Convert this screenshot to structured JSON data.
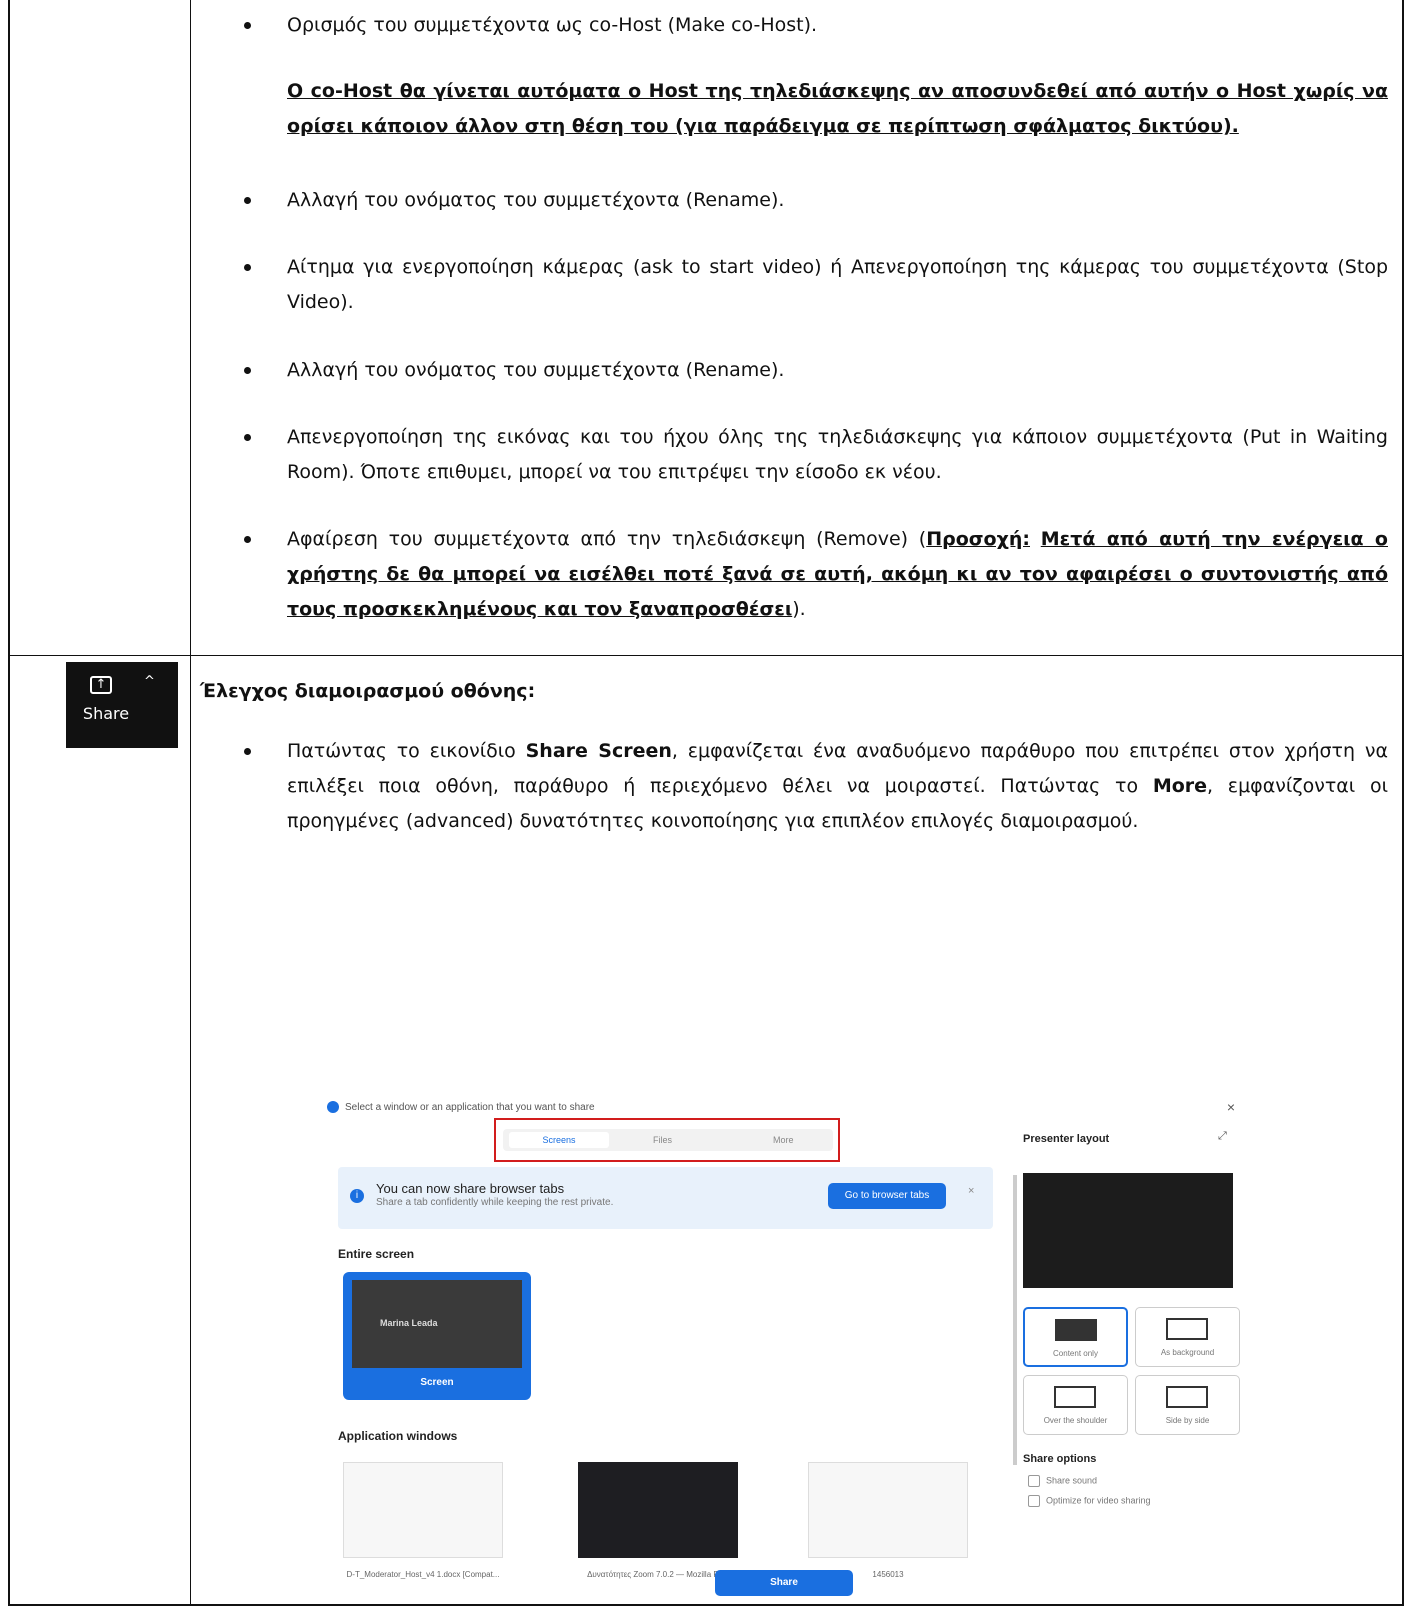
{
  "row1": {
    "bullet1": "Ορισμός του συμμετέχοντα ως co-Host (Make co-Host).",
    "note": "Ο co-Host θα γίνεται αυτόματα ο Host της τηλεδιάσκεψης αν αποσυνδεθεί από αυτήν ο Host χωρίς να ορίσει κάποιον άλλον στη θέση του (για παράδειγμα σε περίπτωση σφάλματος δικτύου).",
    "bullet2": "Αλλαγή του ονόματος του συμμετέχοντα (Rename).",
    "bullet3": "Αίτημα για ενεργοποίηση κάμερας (ask to start video) ή Απενεργοποίηση της κάμερας του συμμετέχοντα (Stop Video).",
    "bullet4": "Αλλαγή του ονόματος του συμμετέχοντα (Rename).",
    "bullet5": "Απενεργοποίηση της εικόνας και του ήχου όλης της τηλεδιάσκεψης για κάποιον συμμετέχοντα (Put in Waiting Room). Όποτε επιθυμει, μπορεί να του επιτρέψει την είσοδο εκ νέου.",
    "bullet6_pre": "Αφαίρεση του συμμετέχοντα από την τηλεδιάσκεψη (Remove) (",
    "bullet6_warn_label": "Προσοχή:",
    "bullet6_warn": "Μετά από αυτή την ενέργεια ο χρήστης δε θα μπορεί να εισέλθει ποτέ ξανά σε αυτή, ακόμη κι αν τον αφαιρέσει ο συντονιστής από τους προσκεκλημένους και τον ξαναπροσθέσει",
    "bullet6_post": ")."
  },
  "row2": {
    "share_icon_label": "Share",
    "heading": "Έλεγχος διαμοιρασμού οθόνης:",
    "bullet_pre": "Πατώντας το εικονίδιο ",
    "bullet_bold1": "Share Screen",
    "bullet_mid": ", εμφανίζεται ένα αναδυόμενο παράθυρο που επιτρέπει στον χρήστη να επιλέξει ποια οθόνη, παράθυρο ή περιεχόμενο θέλει να μοιραστεί. Πατώντας το ",
    "bullet_bold2": "More",
    "bullet_post": ", εμφανίζονται οι προηγμένες (advanced) δυνατότητες κοινοποίησης για επιπλέον επιλογές διαμοιρασμού."
  },
  "zoom": {
    "window_title": "Select a window or an application that you want to share",
    "tabs": [
      "Screens",
      "Files",
      "More"
    ],
    "banner_title": "You can now share browser tabs",
    "banner_sub": "Share a tab confidently while keeping the rest private.",
    "banner_button": "Go to browser tabs",
    "entire_screen": "Entire screen",
    "screen_name": "Marina Leada",
    "screen_label": "Screen",
    "app_windows": "Application windows",
    "thumb_captions": [
      "D-T_Moderator_Host_v4 1.docx [Compat...",
      "Δυνατότητες Zoom 7.0.2 — Mozilla Fir...",
      "1456013"
    ],
    "presenter_layout": "Presenter layout",
    "layouts": [
      "Content only",
      "As background",
      "Over the shoulder",
      "Side by side"
    ],
    "share_options": "Share options",
    "option1": "Share sound",
    "option2": "Optimize for video sharing",
    "share_button": "Share"
  }
}
